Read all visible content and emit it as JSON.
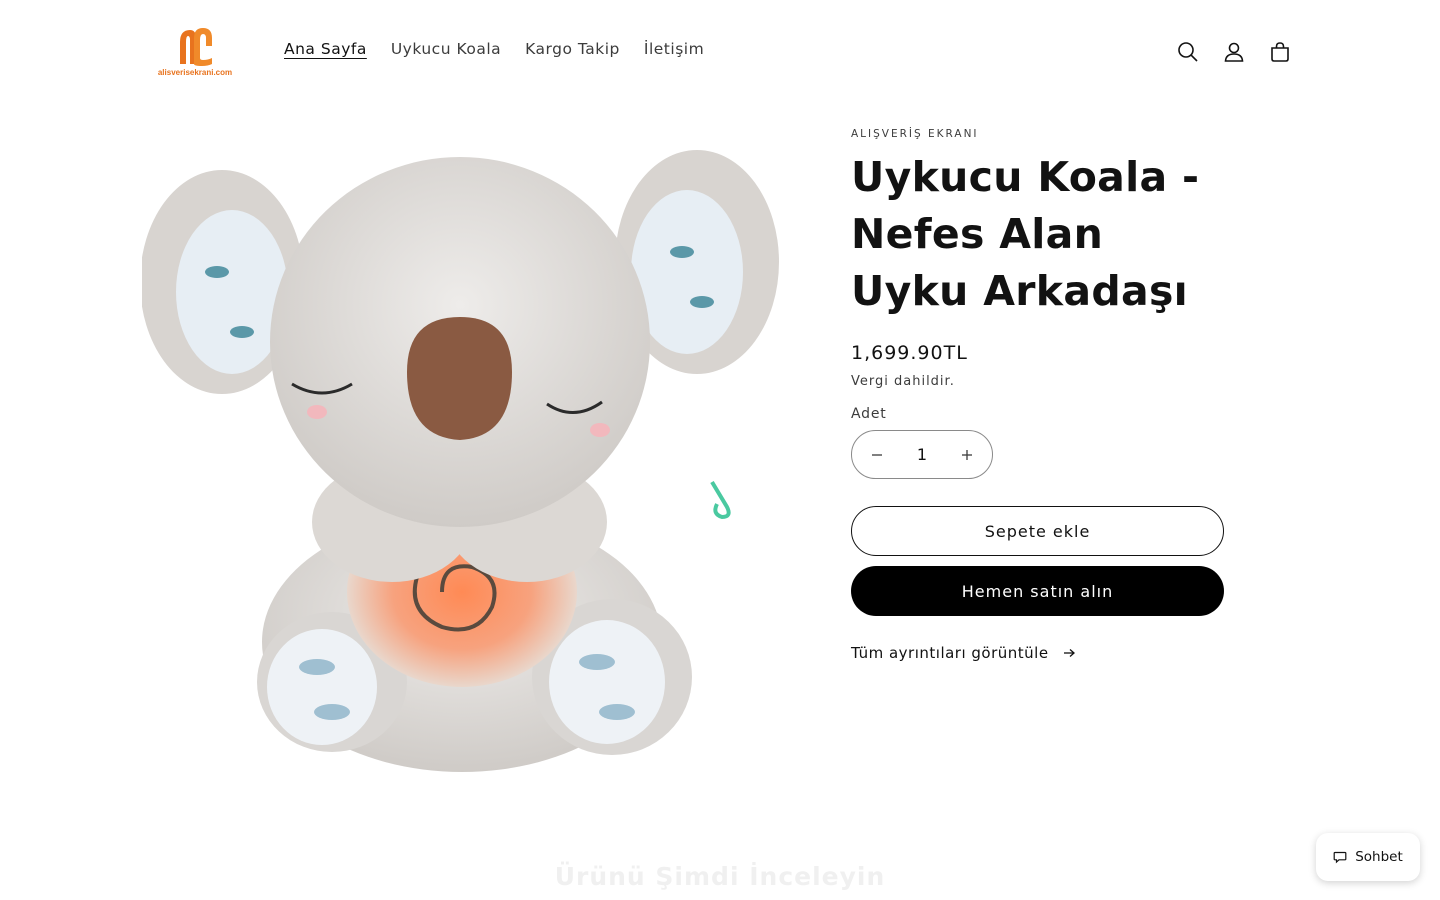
{
  "brand": {
    "logo_text": "alisverisekrani.com",
    "accent_color": "#e8731e"
  },
  "nav": {
    "items": [
      {
        "label": "Ana Sayfa",
        "active": true
      },
      {
        "label": "Uykucu Koala",
        "active": false
      },
      {
        "label": "Kargo Takip",
        "active": false
      },
      {
        "label": "İletişim",
        "active": false
      }
    ]
  },
  "header_icons": [
    "search-icon",
    "account-icon",
    "cart-icon"
  ],
  "product": {
    "vendor": "ALIŞVERİŞ EKRANI",
    "title": "Uykucu Koala - Nefes Alan Uyku Arkadaşı",
    "price": "1,699.90TL",
    "tax_note": "Vergi dahildir.",
    "quantity_label": "Adet",
    "quantity_value": "1",
    "add_to_cart_label": "Sepete ekle",
    "buy_now_label": "Hemen satın alın",
    "details_link_label": "Tüm ayrıntıları görüntüle"
  },
  "section": {
    "heading": "Ürünü Şimdi İnceleyin"
  },
  "chat": {
    "label": "Sohbet"
  }
}
